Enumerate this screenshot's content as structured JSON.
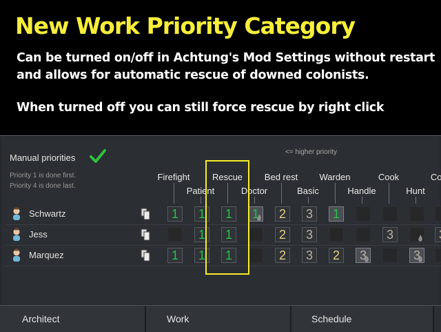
{
  "promo": {
    "title": "New Work Priority Category",
    "line1": "Can be turned on/off in Achtung's Mod Settings without restart",
    "line2": "and allows for automatic rescue of downed colonists.",
    "line3": "When turned off you can still force rescue by right click"
  },
  "panel": {
    "manual_label": "Manual priorities",
    "hint1": "Priority 1 is done first.",
    "hint2": "Priority 4 is done last.",
    "higher_priority": "<= higher priority",
    "columns_top": [
      "Firefight",
      "Rescue",
      "Bed rest",
      "Warden",
      "Cook",
      "Cons"
    ],
    "columns_bottom": [
      "Patient",
      "Doctor",
      "Basic",
      "Handle",
      "Hunt"
    ],
    "colonists": [
      {
        "name": "Schwartz",
        "priorities": [
          "1",
          "1",
          "1",
          "1",
          "2",
          "3",
          "1",
          "",
          "",
          "",
          ""
        ]
      },
      {
        "name": "Jess",
        "priorities": [
          "",
          "1",
          "1",
          "",
          "2",
          "3",
          "",
          "",
          "3",
          "",
          "3"
        ]
      },
      {
        "name": "Marquez",
        "priorities": [
          "1",
          "1",
          "1",
          "",
          "2",
          "3",
          "2",
          "3",
          "",
          "3",
          ""
        ]
      }
    ]
  },
  "tabs": [
    "Architect",
    "Work",
    "Schedule"
  ],
  "colors": {
    "title": "#f6ee3a",
    "priority1": "#27c24a",
    "priority2": "#e2cf86",
    "highlight_box": "#f7ee2a"
  }
}
